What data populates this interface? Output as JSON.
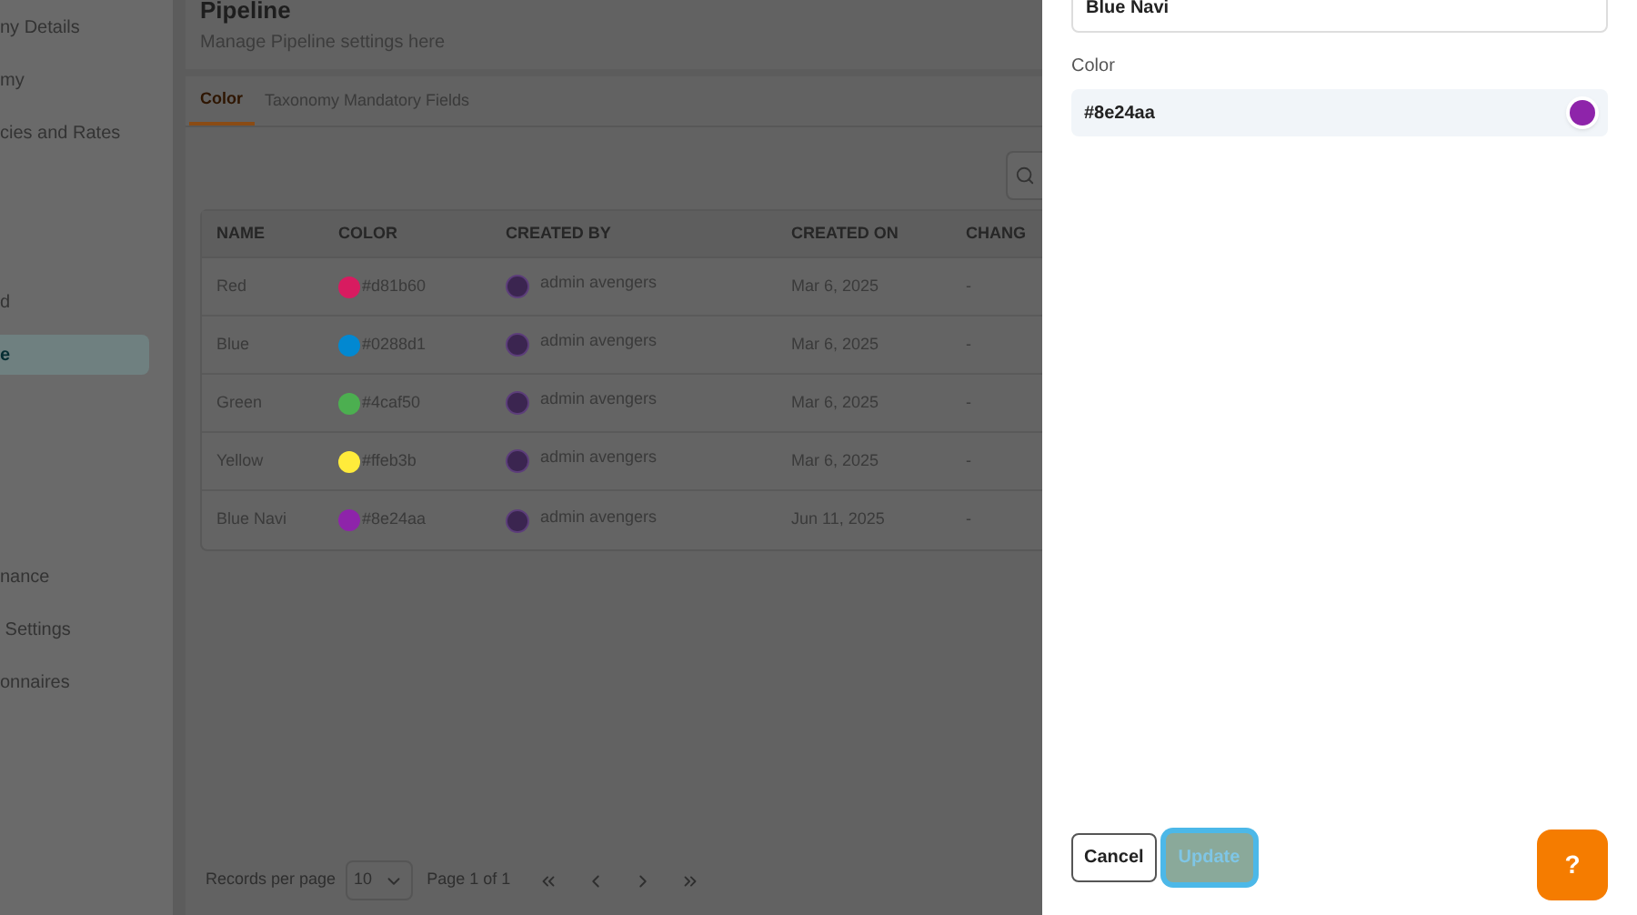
{
  "sidebar": {
    "items": [
      {
        "label": "ny Details",
        "selected": false
      },
      {
        "label": "my",
        "selected": false
      },
      {
        "label": "cies and Rates",
        "selected": false
      },
      {
        "label": "d",
        "selected": false
      },
      {
        "label": "e",
        "selected": true
      },
      {
        "label": "nance",
        "selected": false
      },
      {
        "label": " Settings",
        "selected": false
      },
      {
        "label": "onnaires",
        "selected": false
      }
    ]
  },
  "header": {
    "title": "Pipeline",
    "subtitle": "Manage Pipeline settings here"
  },
  "tabs": [
    {
      "label": "Color",
      "selected": true
    },
    {
      "label": "Taxonomy Mandatory Fields",
      "selected": false
    }
  ],
  "table": {
    "columns": [
      "NAME",
      "COLOR",
      "CREATED BY",
      "CREATED ON",
      "CHANG"
    ],
    "rows": [
      {
        "name": "Red",
        "color": "#d81b60",
        "hex": "#d81b60",
        "created_by": "admin avengers",
        "created_on": "Mar 6, 2025",
        "changed": "-"
      },
      {
        "name": "Blue",
        "color": "#0288d1",
        "hex": "#0288d1",
        "created_by": "admin avengers",
        "created_on": "Mar 6, 2025",
        "changed": "-"
      },
      {
        "name": "Green",
        "color": "#4caf50",
        "hex": "#4caf50",
        "created_by": "admin avengers",
        "created_on": "Mar 6, 2025",
        "changed": "-"
      },
      {
        "name": "Yellow",
        "color": "#ffeb3b",
        "hex": "#ffeb3b",
        "created_by": "admin avengers",
        "created_on": "Mar 6, 2025",
        "changed": "-"
      },
      {
        "name": "Blue Navi",
        "color": "#8e24aa",
        "hex": "#8e24aa",
        "created_by": "admin avengers",
        "created_on": "Jun 11, 2025",
        "changed": "-"
      }
    ]
  },
  "pagination": {
    "label": "Records per page",
    "per_page": "10",
    "page": "Page 1 of 1"
  },
  "drawer": {
    "name_value": "Blue Navi",
    "color_label": "Color",
    "color_value": "#8e24aa",
    "color": "#8e24aa",
    "cancel": "Cancel",
    "update": "Update",
    "update_disabled": true,
    "help": "?"
  }
}
